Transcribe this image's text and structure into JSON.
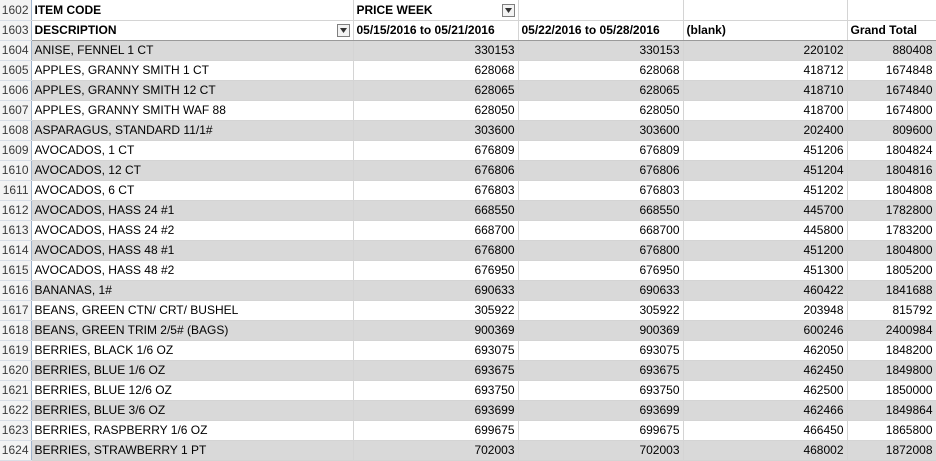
{
  "row_numbers": [
    "1602",
    "1603",
    "1604",
    "1605",
    "1606",
    "1607",
    "1608",
    "1609",
    "1610",
    "1611",
    "1612",
    "1613",
    "1614",
    "1615",
    "1616",
    "1617",
    "1618",
    "1619",
    "1620",
    "1621",
    "1622",
    "1623",
    "1624"
  ],
  "header_row1": {
    "item_code": "ITEM CODE",
    "price_week": "PRICE WEEK"
  },
  "header_row2": {
    "description": "DESCRIPTION",
    "week1": "05/15/2016 to 05/21/2016",
    "week2": "05/22/2016 to 05/28/2016",
    "blank": "(blank)",
    "grand_total": "Grand Total"
  },
  "filter_icon": "dropdown-arrow-icon",
  "rows": [
    {
      "desc": "ANISE, FENNEL 1 CT",
      "w1": "330153",
      "w2": "330153",
      "blank": "220102",
      "total": "880408"
    },
    {
      "desc": "APPLES, GRANNY SMITH 1 CT",
      "w1": "628068",
      "w2": "628068",
      "blank": "418712",
      "total": "1674848"
    },
    {
      "desc": "APPLES, GRANNY SMITH 12 CT",
      "w1": "628065",
      "w2": "628065",
      "blank": "418710",
      "total": "1674840"
    },
    {
      "desc": "APPLES, GRANNY SMITH WAF 88",
      "w1": "628050",
      "w2": "628050",
      "blank": "418700",
      "total": "1674800"
    },
    {
      "desc": "ASPARAGUS, STANDARD 11/1#",
      "w1": "303600",
      "w2": "303600",
      "blank": "202400",
      "total": "809600"
    },
    {
      "desc": "AVOCADOS, 1 CT",
      "w1": "676809",
      "w2": "676809",
      "blank": "451206",
      "total": "1804824"
    },
    {
      "desc": "AVOCADOS, 12 CT",
      "w1": "676806",
      "w2": "676806",
      "blank": "451204",
      "total": "1804816"
    },
    {
      "desc": "AVOCADOS, 6 CT",
      "w1": "676803",
      "w2": "676803",
      "blank": "451202",
      "total": "1804808"
    },
    {
      "desc": "AVOCADOS, HASS 24 #1",
      "w1": "668550",
      "w2": "668550",
      "blank": "445700",
      "total": "1782800"
    },
    {
      "desc": "AVOCADOS, HASS 24 #2",
      "w1": "668700",
      "w2": "668700",
      "blank": "445800",
      "total": "1783200"
    },
    {
      "desc": "AVOCADOS, HASS 48 #1",
      "w1": "676800",
      "w2": "676800",
      "blank": "451200",
      "total": "1804800"
    },
    {
      "desc": "AVOCADOS, HASS 48 #2",
      "w1": "676950",
      "w2": "676950",
      "blank": "451300",
      "total": "1805200"
    },
    {
      "desc": "BANANAS, 1#",
      "w1": "690633",
      "w2": "690633",
      "blank": "460422",
      "total": "1841688"
    },
    {
      "desc": "BEANS, GREEN CTN/ CRT/ BUSHEL",
      "w1": "305922",
      "w2": "305922",
      "blank": "203948",
      "total": "815792"
    },
    {
      "desc": "BEANS, GREEN TRIM 2/5# (BAGS)",
      "w1": "900369",
      "w2": "900369",
      "blank": "600246",
      "total": "2400984"
    },
    {
      "desc": "BERRIES, BLACK 1/6 OZ",
      "w1": "693075",
      "w2": "693075",
      "blank": "462050",
      "total": "1848200"
    },
    {
      "desc": "BERRIES, BLUE 1/6 OZ",
      "w1": "693675",
      "w2": "693675",
      "blank": "462450",
      "total": "1849800"
    },
    {
      "desc": "BERRIES, BLUE 12/6 OZ",
      "w1": "693750",
      "w2": "693750",
      "blank": "462500",
      "total": "1850000"
    },
    {
      "desc": "BERRIES, BLUE 3/6 OZ",
      "w1": "693699",
      "w2": "693699",
      "blank": "462466",
      "total": "1849864"
    },
    {
      "desc": "BERRIES, RASPBERRY 1/6 OZ",
      "w1": "699675",
      "w2": "699675",
      "blank": "466450",
      "total": "1865800"
    },
    {
      "desc": "BERRIES, STRAWBERRY 1 PT",
      "w1": "702003",
      "w2": "702003",
      "blank": "468002",
      "total": "1872008"
    }
  ],
  "colors": {
    "row_shade": "#d9d9d9",
    "row_header_bg": "#f3f3f3",
    "gridline": "#d4d4d4"
  }
}
